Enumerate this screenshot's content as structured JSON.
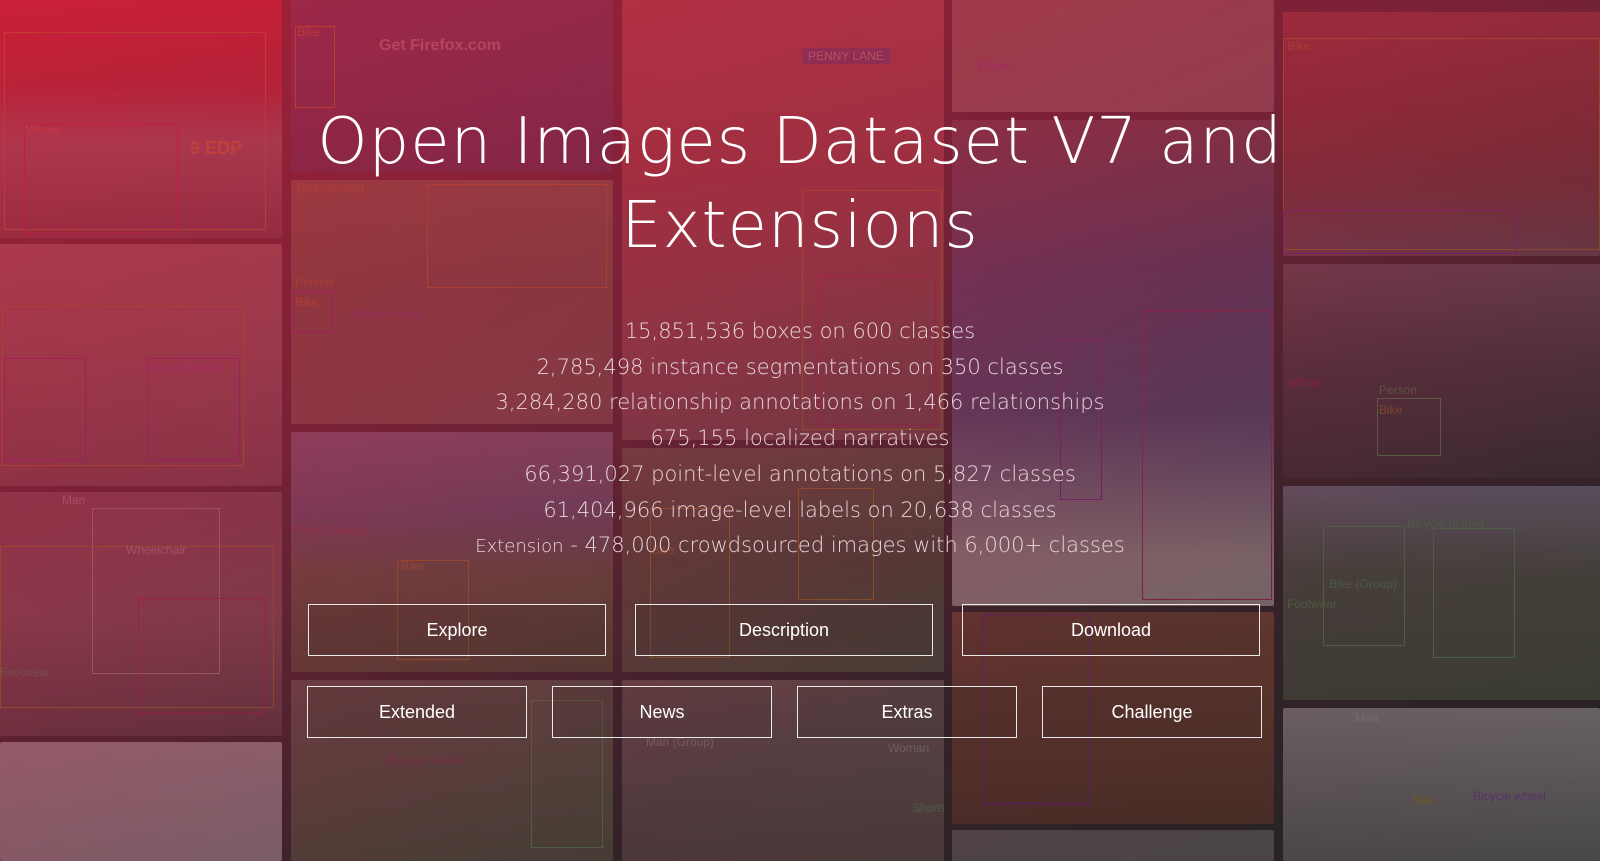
{
  "hero": {
    "title": "Open Images Dataset V7 and Extensions"
  },
  "stats": [
    {
      "text": "15,851,536 boxes on 600 classes"
    },
    {
      "text": "2,785,498 instance segmentations on 350 classes"
    },
    {
      "text": "3,284,280 relationship annotations on 1,466 relationships"
    },
    {
      "text": "675,155 localized narratives"
    },
    {
      "text": "66,391,027 point-level annotations on 5,827 classes"
    },
    {
      "text": "61,404,966 image-level labels on 20,638 classes"
    },
    {
      "prefix": "Extension",
      "text": " - 478,000 crowdsourced images with 6,000+ classes"
    }
  ],
  "buttons_row1": [
    {
      "label": "Explore"
    },
    {
      "label": "Description"
    },
    {
      "label": "Download"
    }
  ],
  "buttons_row2": [
    {
      "label": "Extended"
    },
    {
      "label": "News"
    },
    {
      "label": "Extras"
    },
    {
      "label": "Challenge"
    }
  ],
  "background_labels": {
    "l1": "Bike",
    "l2": "Wheel",
    "l3": "Person",
    "l4": "Man",
    "l5": "Bicycle helmet",
    "l6": "Get Firefox.com",
    "l7": "PENNY LANE",
    "l8": "Tree (Group)",
    "l9": "Bicycle wheel",
    "l10": "9 EDP",
    "l11": "Footwear",
    "l12": "Bike (Group)",
    "l13": "Man (Group)",
    "l14": "Woman",
    "l15": "Wheelchair",
    "l16": "Shorts",
    "l17": "Plant (Group)"
  },
  "colors": {
    "accent_tint": "#c41e3a",
    "button_border": "#e9e9e9",
    "title_text": "#ffffff",
    "stats_text": "#e8d6da"
  }
}
